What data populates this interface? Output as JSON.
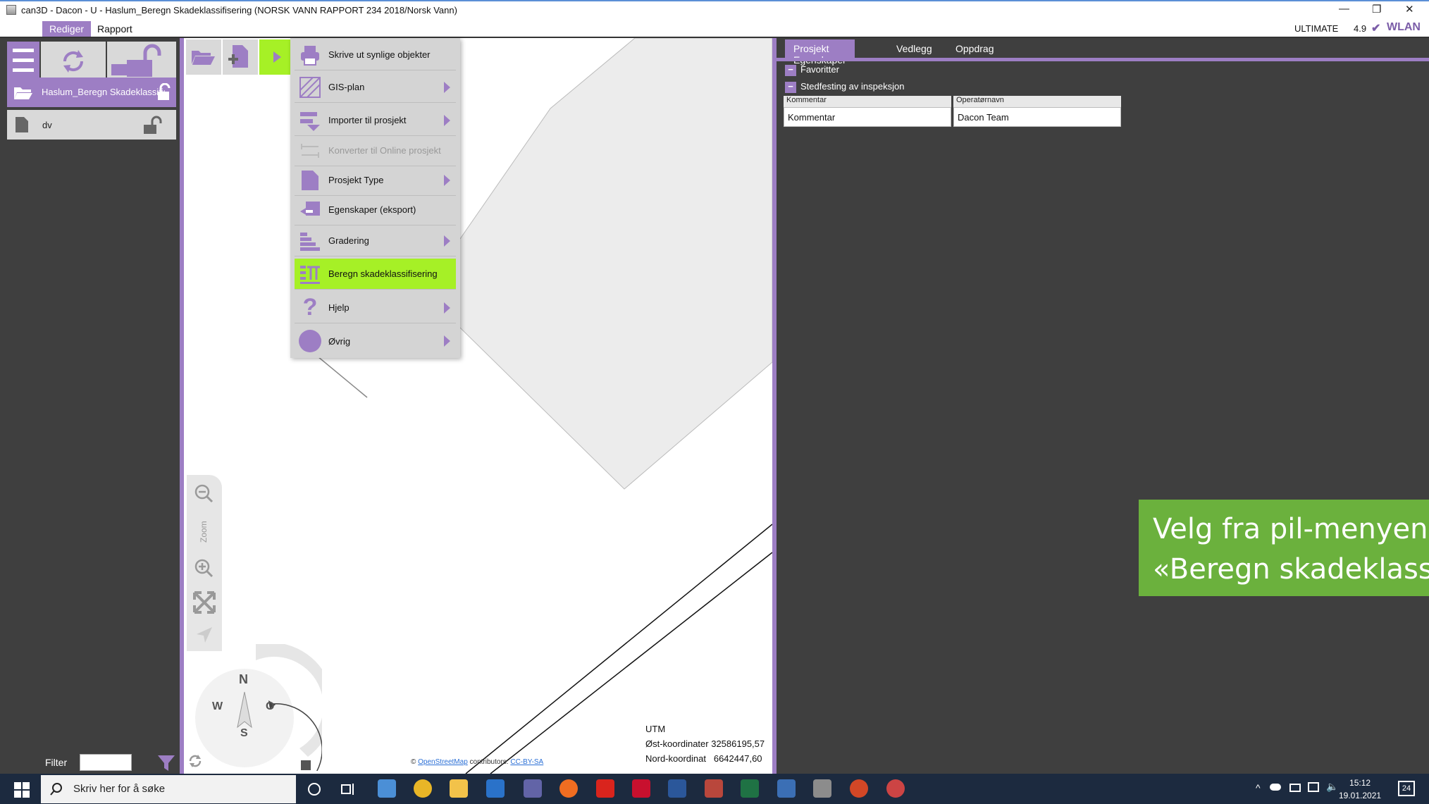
{
  "window": {
    "title": "can3D - Dacon - U - Haslum_Beregn Skadeklassifisering (NORSK VANN RAPPORT 234 2018/Norsk Vann)",
    "edition": "ULTIMATE",
    "version": "4.9",
    "network": "WLAN"
  },
  "menubar": {
    "tabs": [
      "Rediger",
      "Rapport"
    ]
  },
  "left": {
    "project_name": "Haslum_Beregn Skadeklassifisering",
    "item_name": "dv",
    "filter_label": "Filter",
    "filter_value": ""
  },
  "dropdown": {
    "items": [
      {
        "label": "Skrive ut synlige objekter",
        "icon": "printer-icon",
        "submenu": false
      },
      {
        "label": "GIS-plan",
        "icon": "gis-plan-icon",
        "submenu": true
      },
      {
        "label": "Importer til prosjekt",
        "icon": "import-icon",
        "submenu": true
      },
      {
        "label": "Konverter til Online prosjekt",
        "icon": "convert-icon",
        "submenu": false,
        "disabled": true
      },
      {
        "label": "Prosjekt Type",
        "icon": "document-icon",
        "submenu": true
      },
      {
        "label": "Egenskaper (eksport)",
        "icon": "export-icon",
        "submenu": false
      },
      {
        "label": "Gradering",
        "icon": "grading-icon",
        "submenu": true
      },
      {
        "label": "Beregn skadeklassifisering",
        "icon": "calculate-icon",
        "submenu": false,
        "highlighted": true
      },
      {
        "label": "Hjelp",
        "icon": "help-icon",
        "submenu": true
      },
      {
        "label": "Øvrig",
        "icon": "circle-icon",
        "submenu": true
      }
    ]
  },
  "map": {
    "zoom_label": "Zoom",
    "compass": {
      "n": "N",
      "s": "S",
      "w": "W",
      "e": "O"
    },
    "utm": {
      "system": "UTM",
      "east_label": "Øst-koordinater",
      "east_value": "32586195,57",
      "north_label": "Nord-koordinat",
      "north_value": "6642447,60"
    },
    "attribution": {
      "prefix": "©",
      "link1": "OpenStreetMap",
      "middle": "contributors.",
      "link2": "CC-BY-SA"
    }
  },
  "right": {
    "tabs": [
      "Prosjekt Egenskaper",
      "Vedlegg",
      "Oppdrag"
    ],
    "groups": [
      "Favoritter",
      "Stedfesting av inspeksjon"
    ],
    "fields": [
      {
        "label": "Kommentar",
        "value": "Kommentar"
      },
      {
        "label": "Operatørnavn",
        "value": "Dacon Team"
      }
    ],
    "callout_line1": "Velg fra pil-menyen;",
    "callout_line2": "«Beregn skadeklassi"
  },
  "taskbar": {
    "search_placeholder": "Skriv her for å søke",
    "time": "15:12",
    "date": "19.01.2021",
    "notifications": "24"
  },
  "colors": {
    "accent": "#9d7ec4",
    "highlight": "#a6f026",
    "callout": "#6bb13d"
  }
}
